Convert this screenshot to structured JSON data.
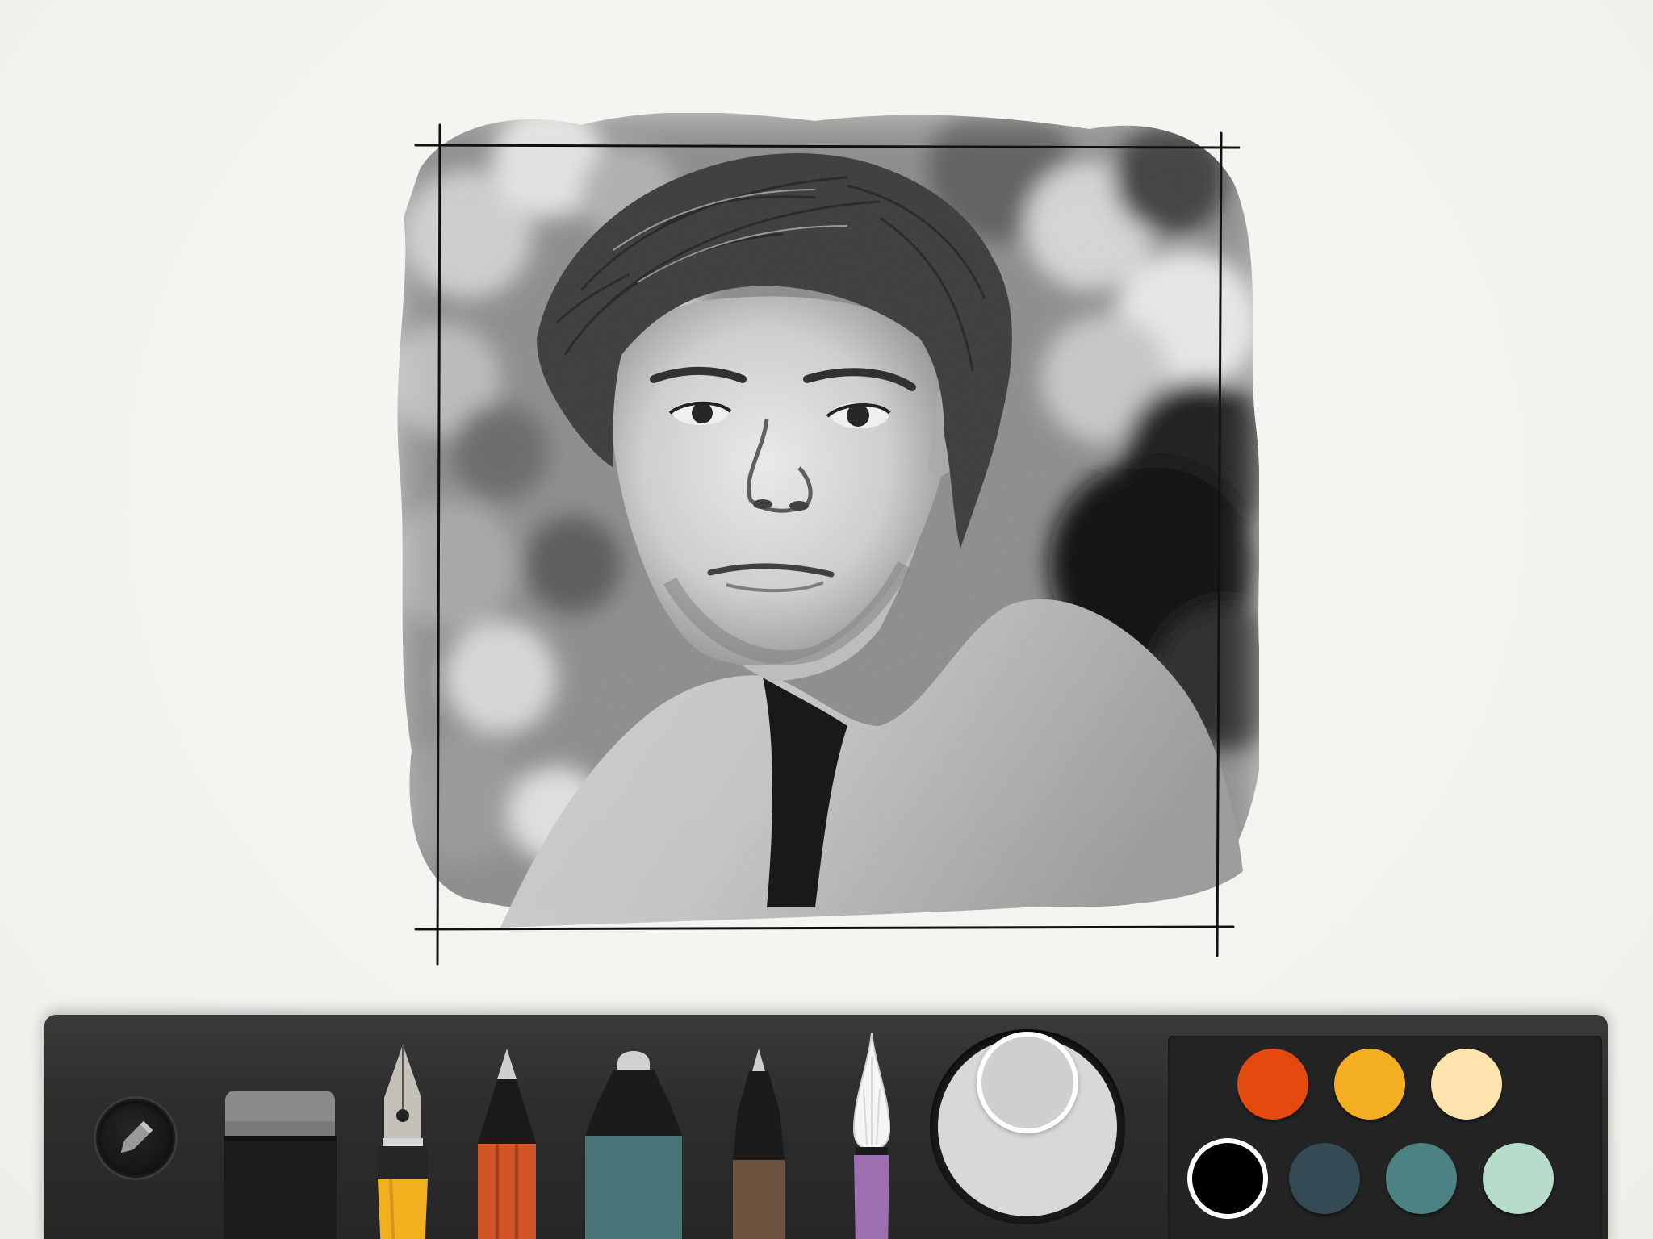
{
  "app": {
    "canvas_background": "#f4f3ef"
  },
  "artwork": {
    "subject": "pencil-portrait-sketch",
    "palette": "grayscale"
  },
  "toolbar": {
    "context_button_icon": "pencil-icon",
    "tools": [
      {
        "id": "erase",
        "icon": "eraser-icon",
        "band_color": "#8a8a8a"
      },
      {
        "id": "sketch",
        "icon": "fountain-pen-icon",
        "band_color": "#f2b01e"
      },
      {
        "id": "pencil",
        "icon": "pencil-tool-icon",
        "band_color": "#d2552a"
      },
      {
        "id": "marker",
        "icon": "marker-icon",
        "band_color": "#4a7578"
      },
      {
        "id": "pen",
        "icon": "pen-icon",
        "band_color": "#7b5c47"
      },
      {
        "id": "watercolor",
        "icon": "brush-icon",
        "band_color": "#9c6fb0"
      }
    ],
    "active_tool": "pencil",
    "size_picker": {
      "value": 0.55,
      "color": "#d8d8d8"
    },
    "swatches": [
      {
        "name": "orange-red",
        "color": "#e44a10",
        "selected": false
      },
      {
        "name": "amber",
        "color": "#f4ae22",
        "selected": false
      },
      {
        "name": "cream",
        "color": "#fde3ad",
        "selected": false
      },
      {
        "name": "black",
        "color": "#000000",
        "selected": true
      },
      {
        "name": "slate-blue",
        "color": "#344a55",
        "selected": false
      },
      {
        "name": "teal",
        "color": "#4d8285",
        "selected": false
      },
      {
        "name": "mint",
        "color": "#b7dcc9",
        "selected": false
      }
    ]
  }
}
